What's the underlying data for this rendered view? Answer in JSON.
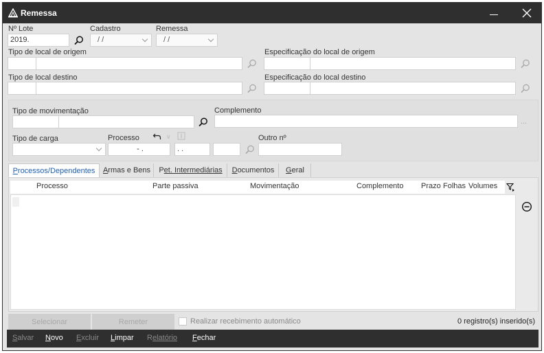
{
  "window": {
    "title": "Remessa"
  },
  "form": {
    "lote_label": "Nº Lote",
    "lote_value": "2019.",
    "cadastro_label": "Cadastro",
    "cadastro_value": "/ /",
    "remessa_label": "Remessa",
    "remessa_value": "/ /",
    "tipo_origem_label": "Tipo de local de origem",
    "espec_origem_label": "Especificação do local de origem",
    "tipo_destino_label": "Tipo de local destino",
    "espec_destino_label": "Especificação do local destino",
    "tipo_mov_label": "Tipo de movimentação",
    "complemento_label": "Complemento",
    "complemento_ellipsis": "...",
    "tipo_carga_label": "Tipo de carga",
    "processo_label": "Processo",
    "processo_part1": "- .",
    "processo_part2": ". .",
    "outro_label": "Outro nº"
  },
  "tabs": [
    {
      "first": "P",
      "rest": "rocessos/Dependentes",
      "active": true
    },
    {
      "first": "A",
      "rest": "rmas e Bens",
      "active": false
    },
    {
      "first": "P",
      "rest": "et. Intermediárias",
      "active": false
    },
    {
      "first": "D",
      "rest": "ocumentos",
      "active": false
    },
    {
      "first": "G",
      "rest": "eral",
      "active": false
    }
  ],
  "grid": {
    "columns": [
      "Processo",
      "Parte passiva",
      "Movimentação",
      "Complemento",
      "Prazo",
      "Folhas",
      "Volumes"
    ]
  },
  "bottom": {
    "selecionar": "Selecionar",
    "remeter": "Remeter",
    "checkbox_label": "Realizar recebimento automático",
    "status": "0 registro(s) inserido(s)"
  },
  "footer": {
    "salvar": {
      "first": "S",
      "rest": "alvar"
    },
    "novo": {
      "first": "N",
      "rest": "ovo"
    },
    "excluir": {
      "first": "E",
      "rest": "xcluir"
    },
    "limpar": {
      "first": "L",
      "rest": "impar"
    },
    "relatorio": {
      "first": "R",
      "rest": "elatório"
    },
    "fechar": {
      "first": "F",
      "rest": "echar"
    }
  },
  "colors": {
    "titlebar": "#2f2f2f",
    "active_tab_text": "#2060b0",
    "window_bg": "#e4e4e4"
  },
  "icons": [
    "app-icon",
    "minimize-icon",
    "close-icon",
    "search-icon",
    "undo-icon",
    "info-icon",
    "filter-icon",
    "remove-icon"
  ]
}
